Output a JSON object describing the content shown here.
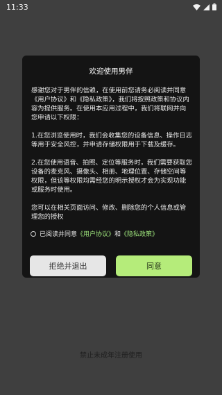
{
  "status": {
    "time": "11:33"
  },
  "dialog": {
    "title": "欢迎使用男伴",
    "paragraphs": [
      "感谢您对于男伴的信赖，在使用前您请务必阅读并同意《用户协议》和《隐私政策》，我们将按照政策和协议内容为提供服务。在使用本应用过程中，我们将联网并向您申请以下权限：",
      "1.在您浏览使用时，我们会收集您的设备信息、操作日志等用于安全风控，并申请存储权限用于下载及缓存。",
      "2.在您使用语音、拍照、定位等服务时，我们需要获取您设备的麦克风、摄像头、相册、地理位置、存储空间等权限，但该等权限均需经您的明示授权才会为实现功能或服务时使用。",
      "您可以在相关页面访问、修改、删除您的个人信息或管理您的授权"
    ],
    "agree": {
      "prefix": "已阅读并同意",
      "user_agreement": "《用户协议》",
      "and": "和",
      "privacy_policy": "《隐私政策》"
    },
    "reject_label": "拒绝并退出",
    "agree_label": "同意"
  },
  "footer": {
    "text": "禁止未成年注册使用"
  },
  "colors": {
    "accent": "#b5ec7a",
    "link": "#9be07a",
    "dialog_bg": "#141414",
    "page_bg": "#3f3f3f"
  },
  "icons": [
    "wifi-icon",
    "signal-icon",
    "battery-icon"
  ]
}
